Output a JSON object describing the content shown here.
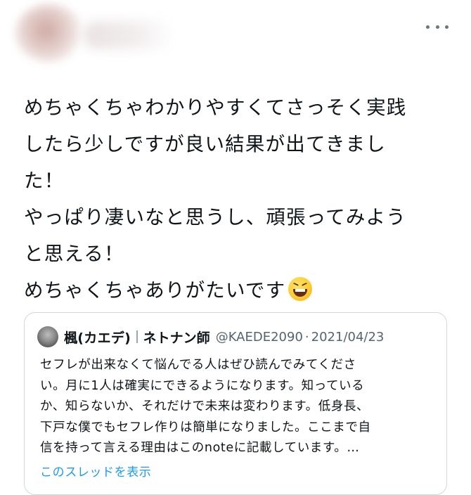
{
  "tweet": {
    "lines": [
      "めちゃくちゃわかりやすくてさっそく実践",
      "したら少しですが良い結果が出てきまし",
      "た！",
      "やっぱり凄いなと思うし、頑張ってみよう",
      "と思える！",
      "めちゃくちゃありがたいです"
    ],
    "emoji": "grinning-squinting-face"
  },
  "quote": {
    "name": "楓(カエデ)",
    "title": "ネトナン師",
    "handle": "@KAEDE2090",
    "separator_dot": "·",
    "date": "2021/04/23",
    "lines": [
      "セフレが出来なくて悩んでる人はぜひ読んでみてくださ",
      "い。月に1人は確実にできるようになります。知っている",
      "か、知らないか、それだけで未来は変わります。低身長、",
      "下戸な僕でもセフレ作りは簡単になりました。ここまで自",
      "信を持って言える理由はこのnoteに記載しています。…"
    ],
    "show_thread": "このスレッドを表示"
  },
  "colors": {
    "text": "#0f1419",
    "secondary": "#536471",
    "link": "#1d9bf0",
    "border": "#cfd9de"
  }
}
